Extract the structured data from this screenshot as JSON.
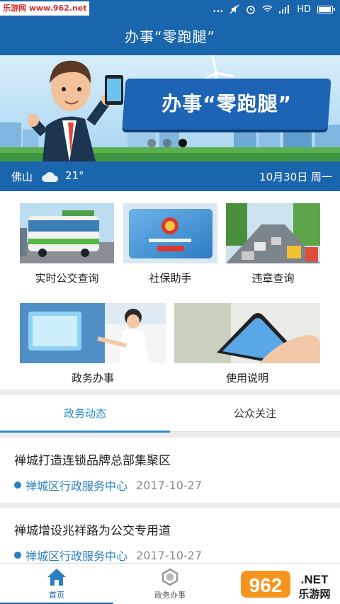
{
  "status_bar": {
    "watermark": "乐游网 www.962.net",
    "dots": "...",
    "network": "HD"
  },
  "header": {
    "title": "办事“零跑腿”"
  },
  "banner": {
    "slogan": "办事“零跑腿”",
    "slide_count": 3,
    "active_slide": 3
  },
  "weather": {
    "city": "佛山",
    "icon": "cloud-icon",
    "temperature": "21°",
    "date": "10月30日 周一"
  },
  "services": [
    {
      "label": "实时公交查询",
      "icon": "bus-photo"
    },
    {
      "label": "社保助手",
      "icon": "social-security-card-photo"
    },
    {
      "label": "违章查询",
      "icon": "traffic-photo"
    },
    {
      "label": "政务办事",
      "icon": "service-hall-photo"
    },
    {
      "label": "使用说明",
      "icon": "phone-in-hand-photo"
    }
  ],
  "tabs": [
    {
      "label": "政务动态",
      "active": true
    },
    {
      "label": "公众关注",
      "active": false
    }
  ],
  "news": [
    {
      "title": "禅城打造连锁品牌总部集聚区",
      "source": "禅城区行政服务中心",
      "date": "2017-10-27"
    },
    {
      "title": "禅城增设兆祥路为公交专用道",
      "source": "禅城区行政服务中心",
      "date": "2017-10-27"
    }
  ],
  "bottom_nav": [
    {
      "label": "首页",
      "icon": "home-icon",
      "active": true
    },
    {
      "label": "政务办事",
      "icon": "service-icon",
      "active": false
    }
  ],
  "overlay_logo": {
    "number": "962",
    "suffix": ".NET",
    "name": "乐游网"
  },
  "colors": {
    "primary": "#1a66ad",
    "accent": "#2a8fd0",
    "source_text": "#2a7fc1"
  }
}
